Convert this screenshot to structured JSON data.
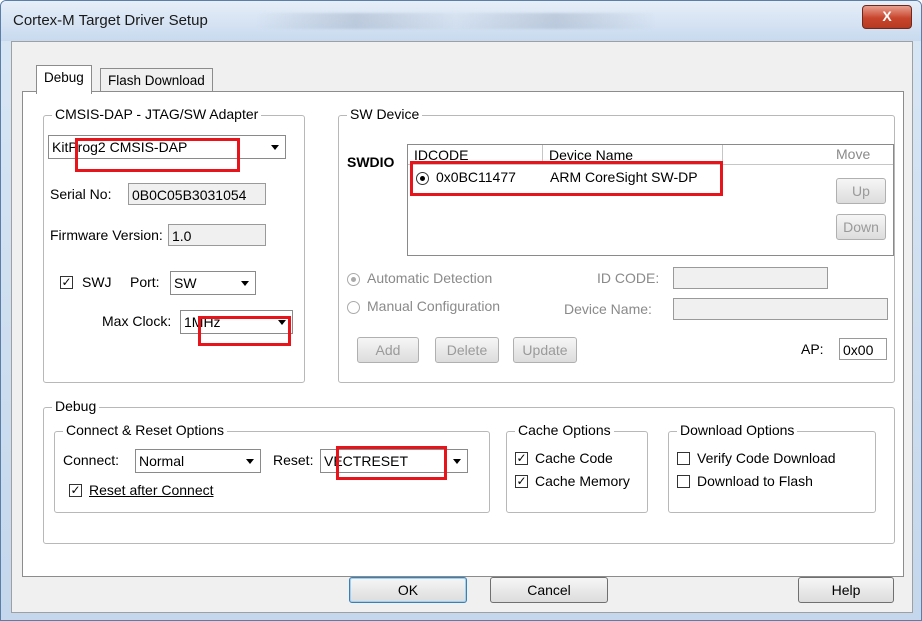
{
  "window": {
    "title": "Cortex-M Target Driver Setup",
    "close_label": "X"
  },
  "tabs": [
    {
      "label": "Debug",
      "active": true
    },
    {
      "label": "Flash Download",
      "active": false
    }
  ],
  "adapter": {
    "group_label": "CMSIS-DAP - JTAG/SW Adapter",
    "selected": "KitProg2 CMSIS-DAP",
    "serial_label": "Serial No:",
    "serial_value": "0B0C05B3031054",
    "firmware_label": "Firmware Version:",
    "firmware_value": "1.0",
    "swj_label": "SWJ",
    "swj_checked": true,
    "port_label": "Port:",
    "port_value": "SW",
    "maxclock_label": "Max Clock:",
    "maxclock_value": "1MHz"
  },
  "sw_device": {
    "group_label": "SW Device",
    "row_label": "SWDIO",
    "columns": [
      "IDCODE",
      "Device Name"
    ],
    "rows": [
      {
        "idcode": "0x0BC11477",
        "device_name": "ARM CoreSight SW-DP",
        "selected": true
      }
    ],
    "move_label": "Move",
    "up_label": "Up",
    "down_label": "Down",
    "auto_detect_label": "Automatic Detection",
    "manual_config_label": "Manual Configuration",
    "id_code_label": "ID CODE:",
    "device_name_label": "Device Name:",
    "add_label": "Add",
    "delete_label": "Delete",
    "update_label": "Update",
    "ap_label": "AP:",
    "ap_value": "0x00"
  },
  "debug": {
    "group_label": "Debug",
    "connect_reset": {
      "group_label": "Connect & Reset Options",
      "connect_label": "Connect:",
      "connect_value": "Normal",
      "reset_label": "Reset:",
      "reset_value": "VECTRESET",
      "reset_after_connect_label": "Reset after Connect",
      "reset_after_connect_checked": true
    },
    "cache": {
      "group_label": "Cache Options",
      "cache_code_label": "Cache Code",
      "cache_code_checked": true,
      "cache_memory_label": "Cache Memory",
      "cache_memory_checked": true
    },
    "download": {
      "group_label": "Download Options",
      "verify_label": "Verify Code Download",
      "verify_checked": false,
      "flash_label": "Download to Flash",
      "flash_checked": false
    }
  },
  "footer": {
    "ok_label": "OK",
    "cancel_label": "Cancel",
    "help_label": "Help"
  },
  "colors": {
    "highlight": "#e8141c",
    "titlebar": "#c8daef",
    "close": "#c8452c"
  },
  "icons": {
    "check": "✓",
    "close": "X"
  }
}
